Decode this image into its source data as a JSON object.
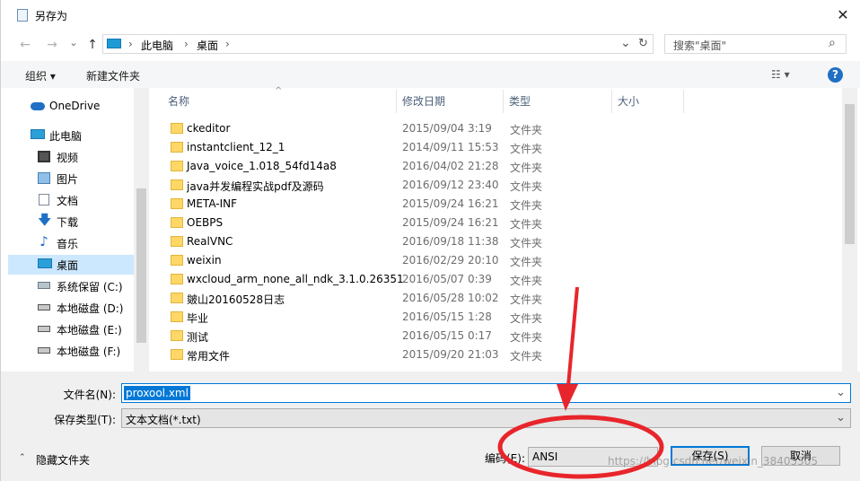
{
  "window": {
    "title": "另存为",
    "close": "✕"
  },
  "nav": {
    "back": "←",
    "forward": "→",
    "dropdown": "⌄",
    "up": "↑",
    "breadcrumb": [
      "此电脑",
      "桌面"
    ],
    "sep": "›",
    "refresh": "↻",
    "search_placeholder": "搜索\"桌面\"",
    "search_icon": "⌕"
  },
  "toolbar": {
    "organize": "组织 ▾",
    "new_folder": "新建文件夹",
    "view": "☷ ▾",
    "help": "?"
  },
  "sidebar": {
    "items": [
      {
        "label": "OneDrive",
        "icon": "cloud-icon"
      },
      {
        "label": "此电脑",
        "icon": "computer-icon"
      },
      {
        "label": "视频",
        "icon": "video-icon"
      },
      {
        "label": "图片",
        "icon": "pictures-icon"
      },
      {
        "label": "文档",
        "icon": "documents-icon"
      },
      {
        "label": "下载",
        "icon": "download-icon"
      },
      {
        "label": "音乐",
        "icon": "music-icon"
      },
      {
        "label": "桌面",
        "icon": "desktop-icon",
        "selected": true
      },
      {
        "label": "系统保留 (C:)",
        "icon": "drive-icon"
      },
      {
        "label": "本地磁盘 (D:)",
        "icon": "drive-icon"
      },
      {
        "label": "本地磁盘 (E:)",
        "icon": "drive-icon"
      },
      {
        "label": "本地磁盘 (F:)",
        "icon": "drive-icon"
      }
    ]
  },
  "columns": {
    "name": "名称",
    "date": "修改日期",
    "type": "类型",
    "size": "大小"
  },
  "files": [
    {
      "name": "ckeditor",
      "date": "2015/09/04 3:19",
      "type": "文件夹"
    },
    {
      "name": "instantclient_12_1",
      "date": "2014/09/11 15:53",
      "type": "文件夹"
    },
    {
      "name": "Java_voice_1.018_54fd14a8",
      "date": "2016/04/02 21:28",
      "type": "文件夹"
    },
    {
      "name": "java并发编程实战pdf及源码",
      "date": "2016/09/12 23:40",
      "type": "文件夹"
    },
    {
      "name": "META-INF",
      "date": "2015/09/24 16:21",
      "type": "文件夹"
    },
    {
      "name": "OEBPS",
      "date": "2015/09/24 16:21",
      "type": "文件夹"
    },
    {
      "name": "RealVNC",
      "date": "2016/09/18 11:38",
      "type": "文件夹"
    },
    {
      "name": "weixin",
      "date": "2016/02/29 20:10",
      "type": "文件夹"
    },
    {
      "name": "wxcloud_arm_none_all_ndk_3.1.0.26351",
      "date": "2016/05/07 0:39",
      "type": "文件夹"
    },
    {
      "name": "皴山20160528日志",
      "date": "2016/05/28 10:02",
      "type": "文件夹"
    },
    {
      "name": "毕业",
      "date": "2016/05/15 1:28",
      "type": "文件夹"
    },
    {
      "name": "测试",
      "date": "2016/05/15 0:17",
      "type": "文件夹"
    },
    {
      "name": "常用文件",
      "date": "2015/09/20 21:03",
      "type": "文件夹"
    }
  ],
  "form": {
    "filename_label": "文件名(N):",
    "filename_value": "proxool.xml",
    "filetype_label": "保存类型(T):",
    "filetype_value": "文本文档(*.txt)",
    "hide_folders": "隐藏文件夹",
    "encoding_label": "编码(E):",
    "encoding_value": "ANSI",
    "save": "保存(S)",
    "cancel": "取消"
  },
  "watermark": "https://blog.csdn.net/weixin_38405305",
  "colors": {
    "annotation": "#e8252b",
    "accent": "#0078d7",
    "selection": "#cce8ff",
    "folder": "#ffd766"
  }
}
